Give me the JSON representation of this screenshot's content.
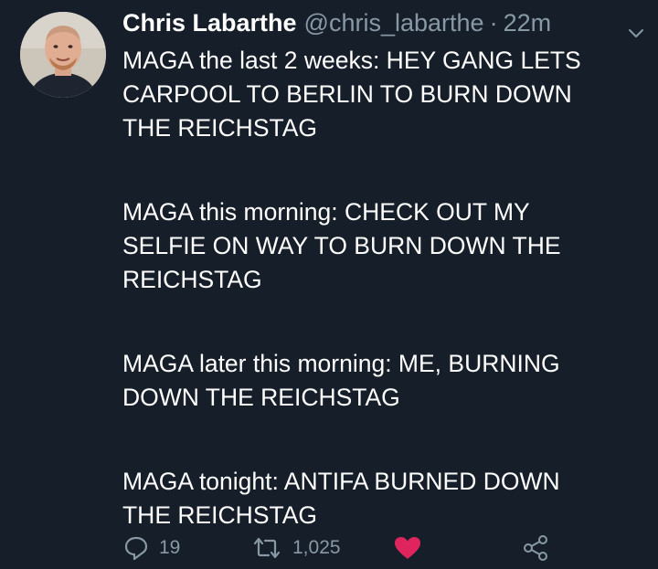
{
  "tweet": {
    "display_name": "Chris Labarthe",
    "handle": "@chris_labarthe",
    "separator": "·",
    "time": "22m",
    "paragraphs": [
      "MAGA the last 2 weeks: HEY GANG LETS\nCARPOOL TO BERLIN TO BURN DOWN\nTHE REICHSTAG",
      "MAGA this morning: CHECK OUT MY\nSELFIE ON WAY TO BURN DOWN THE\nREICHSTAG",
      "MAGA later this morning: ME, BURNING\nDOWN THE REICHSTAG",
      "MAGA tonight: ANTIFA BURNED DOWN\nTHE REICHSTAG"
    ],
    "reply_count": "19",
    "retweet_count": "1,025"
  },
  "icons": {
    "reply": "reply-icon",
    "retweet": "retweet-icon",
    "like": "heart-icon",
    "share": "share-icon",
    "menu": "chevron-down-icon"
  },
  "colors": {
    "background": "#161e29",
    "text": "#ffffff",
    "muted": "#8899a6",
    "like": "#e0245e"
  }
}
